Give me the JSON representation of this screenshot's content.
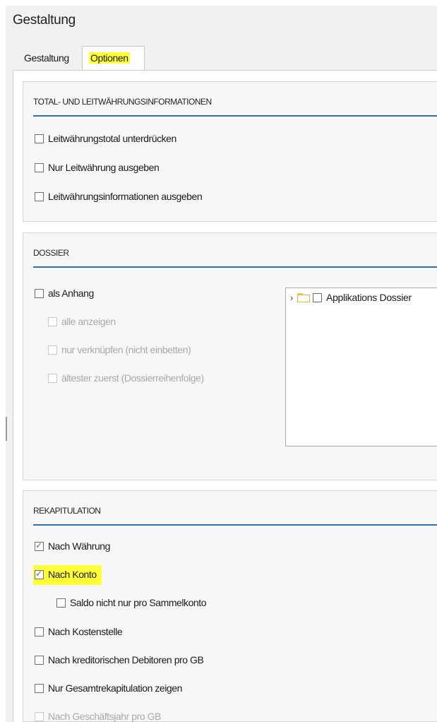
{
  "window": {
    "title": "Gestaltung"
  },
  "tabs": [
    {
      "label": "Gestaltung",
      "active": false
    },
    {
      "label": "Optionen",
      "active": true
    }
  ],
  "sections": {
    "totals": {
      "title": "TOTAL- UND LEITWÄHRUNGSINFORMATIONEN",
      "options": [
        {
          "label": "Leitwährungstotal unterdrücken",
          "checked": false
        },
        {
          "label": "Nur Leitwährung ausgeben",
          "checked": false
        },
        {
          "label": "Leitwährungsinformationen ausgeben",
          "checked": false
        }
      ]
    },
    "dossier": {
      "title": "DOSSIER",
      "options": [
        {
          "label": "als Anhang",
          "checked": false,
          "enabled": true
        },
        {
          "label": "alle anzeigen",
          "checked": false,
          "enabled": false
        },
        {
          "label": "nur verknüpfen (nicht einbetten)",
          "checked": false,
          "enabled": false
        },
        {
          "label": "ältester zuerst (Dossierreihenfolge)",
          "checked": false,
          "enabled": false
        }
      ],
      "tree": {
        "item_label": "Applikations Dossier",
        "expanded": false,
        "checked": false
      }
    },
    "recap": {
      "title": "REKAPITULATION",
      "options": [
        {
          "label": "Nach Währung",
          "checked": true,
          "enabled": true
        },
        {
          "label": "Nach Konto",
          "checked": true,
          "enabled": true,
          "highlighted": true
        },
        {
          "label": "Saldo nicht nur pro Sammelkonto",
          "checked": false,
          "enabled": true
        },
        {
          "label": "Nach Kostenstelle",
          "checked": false,
          "enabled": true
        },
        {
          "label": "Nach kreditorischen Debitoren pro GB",
          "checked": false,
          "enabled": true
        },
        {
          "label": "Nur Gesamtrekapitulation zeigen",
          "checked": false,
          "enabled": true
        },
        {
          "label": "Nach Geschäftsjahr pro GB",
          "checked": false,
          "enabled": false
        }
      ]
    }
  },
  "colors": {
    "accent_line": "#2f6fb3",
    "highlight": "#ffff34",
    "folder": "#f0b52a"
  },
  "icons": {
    "tree_expand": "chevron-right-icon",
    "tree_folder": "folder-icon"
  }
}
